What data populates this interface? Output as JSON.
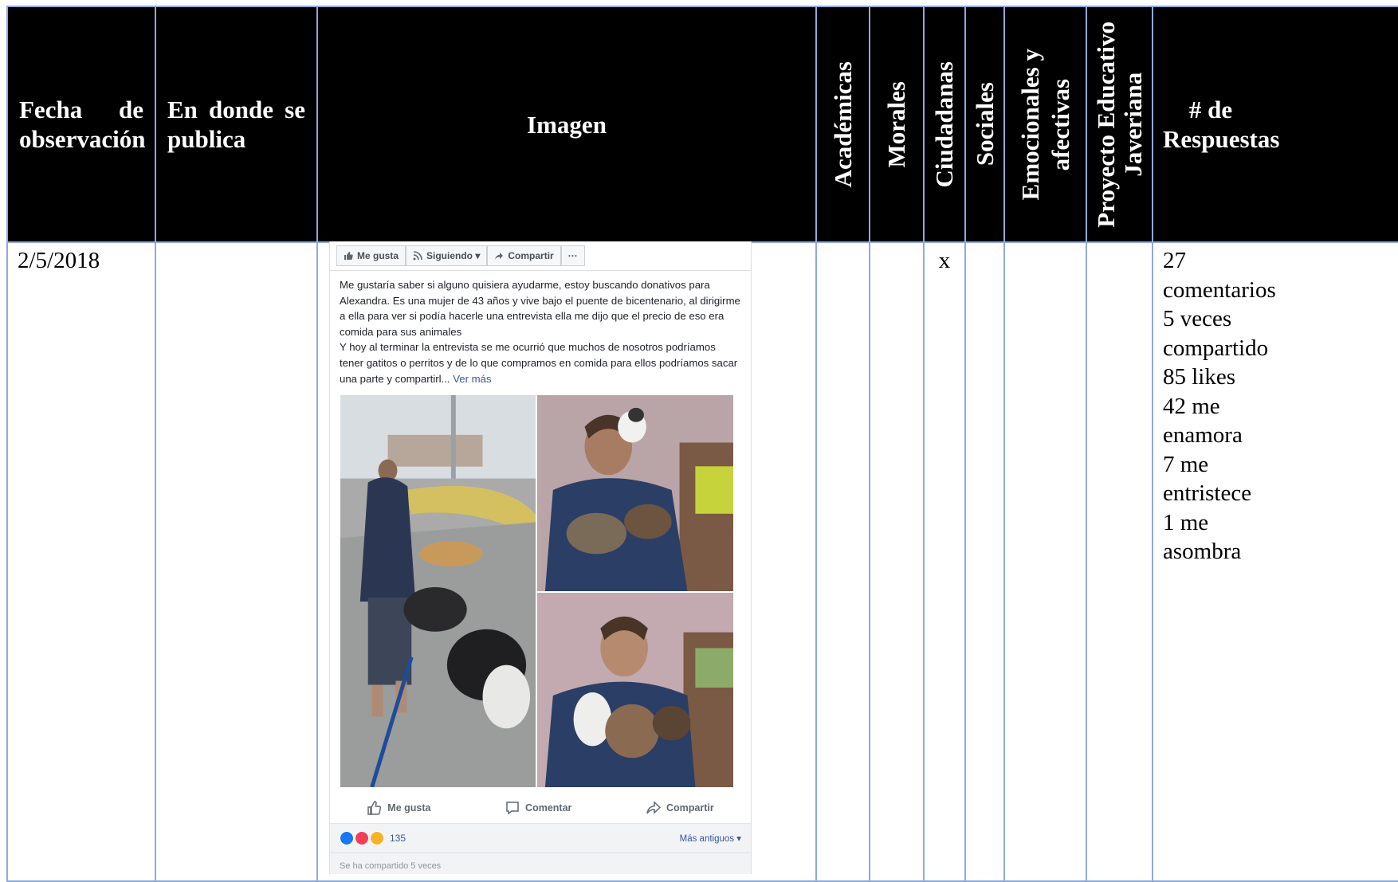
{
  "headers": {
    "fecha": "Fecha de observación",
    "publica": "En donde se publica",
    "imagen": "Imagen",
    "academicas": "Académicas",
    "morales": "Morales",
    "ciudadanas": "Ciudadanas",
    "sociales": "Sociales",
    "emocionales_l1": "Emocionales y",
    "emocionales_l2": "afectivas",
    "pej_l1": "Proyecto Educativo",
    "pej_l2": "Javeriana",
    "respuestas": "# de Respuestas"
  },
  "row": {
    "fecha": "2/5/2018",
    "publica": "",
    "academicas": "",
    "morales": "",
    "ciudadanas": "x",
    "sociales": "",
    "emocionales": "",
    "pej": "",
    "respuestas": {
      "comentarios": "27 comentarios",
      "compartido": "5 veces compartido",
      "likes": "85 likes",
      "enamora": "42 me enamora",
      "entristece": "7 me entristece",
      "asombra": "1 me asombra"
    }
  },
  "post": {
    "top_buttons": {
      "like": "Me gusta",
      "follow": "Siguiendo ▾",
      "share": "Compartir",
      "more": "···"
    },
    "text_p1": "Me gustaría saber si alguno quisiera ayudarme, estoy buscando donativos para Alexandra. Es una mujer de 43 años y vive bajo el puente de bicentenario, al dirigirme a ella para ver si podía hacerle una entrevista ella me dijo que el precio de eso era comida para sus animales",
    "text_p2": "Y hoy al terminar la entrevista se me ocurrió que muchos de nosotros podríamos tener gatitos o perritos y de lo que compramos en comida para ellos podríamos sacar una parte y compartirl...",
    "see_more": "Ver más",
    "actions": {
      "like": "Me gusta",
      "comment": "Comentar",
      "share": "Compartir"
    },
    "reaction_count": "135",
    "sort_label": "Más antiguos ▾",
    "shared_text": "Se ha compartido 5 veces",
    "colors": {
      "link": "#385898",
      "like_blue": "#1877f2",
      "love_red": "#f33e58",
      "sad_yellow": "#f7b125"
    }
  }
}
